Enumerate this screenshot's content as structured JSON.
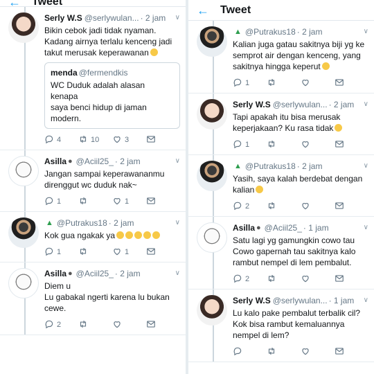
{
  "header": {
    "title_left": "Tweet",
    "title_right": "Tweet"
  },
  "left": [
    {
      "avatar": "girl",
      "name": "Serly W.S",
      "handle": "@serlywulan...",
      "time": "· 2 jam",
      "text": "Bikin cebok jadi tidak nyaman.\nKadang airnya terlalu kenceng jadi\ntakut merusak keperawanan",
      "emoji": true,
      "quote": {
        "name": "menda",
        "handle": "@fermendkis",
        "text": "WC Duduk adalah alasan kenapa\nsaya benci hidup di jaman\nmodern."
      },
      "counts": {
        "reply": "4",
        "retweet": "10",
        "like": "3"
      }
    },
    {
      "avatar": "cat",
      "name": "Asilla",
      "handle": "@Aciil25_",
      "time": "· 2 jam",
      "text": "Jangan sampai keperawananmu\ndirenggut wc duduk nak~",
      "counts": {
        "reply": "1",
        "retweet": "",
        "like": "1"
      }
    },
    {
      "avatar": "man",
      "name": "",
      "handle": "@Putrakus18",
      "time": "· 2 jam",
      "text": "Kok gua ngakak ya",
      "emojiRow": 5,
      "counts": {
        "reply": "1",
        "retweet": "",
        "like": "1"
      }
    },
    {
      "avatar": "cat",
      "name": "Asilla",
      "handle": "@Aciil25_",
      "time": "· 2 jam",
      "text": "Diem u\nLu gabakal ngerti karena lu bukan\ncewe.",
      "counts": {
        "reply": "2",
        "retweet": "",
        "like": ""
      }
    }
  ],
  "right": [
    {
      "avatar": "man",
      "name": "",
      "handle": "@Putrakus18",
      "time": "· 2 jam",
      "text": "Kalian juga gatau sakitnya biji yg ke\nsemprot air dengan kenceng, yang\nsakitnya hingga keperut",
      "emoji": true,
      "counts": {
        "reply": "1",
        "retweet": "",
        "like": ""
      }
    },
    {
      "avatar": "girl",
      "name": "Serly W.S",
      "handle": "@serlywulan...",
      "time": "· 2 jam",
      "text": "Tapi apakah itu bisa merusak\nkeperjakaan? Ku rasa tidak",
      "emoji": true,
      "counts": {
        "reply": "1",
        "retweet": "",
        "like": ""
      }
    },
    {
      "avatar": "man",
      "name": "",
      "handle": "@Putrakus18",
      "time": "· 2 jam",
      "text": "Yasih, saya kalah berdebat dengan\nkalian",
      "emoji": true,
      "counts": {
        "reply": "2",
        "retweet": "",
        "like": ""
      }
    },
    {
      "avatar": "cat",
      "name": "Asilla",
      "handle": "@Aciil25_",
      "time": "· 1 jam",
      "text": "Satu lagi yg gamungkin cowo tau\nCowo gapernah tau sakitnya kalo\nrambut nempel di lem pembalut.",
      "counts": {
        "reply": "2",
        "retweet": "",
        "like": ""
      }
    },
    {
      "avatar": "girl",
      "name": "Serly W.S",
      "handle": "@serlywulan...",
      "time": "· 1 jam",
      "text": "Lu kalo pake pembalut terbalik cil?\nKok bisa rambut kemaluannya\nnempel di lem?",
      "counts": {
        "reply": "",
        "retweet": "",
        "like": ""
      }
    }
  ]
}
